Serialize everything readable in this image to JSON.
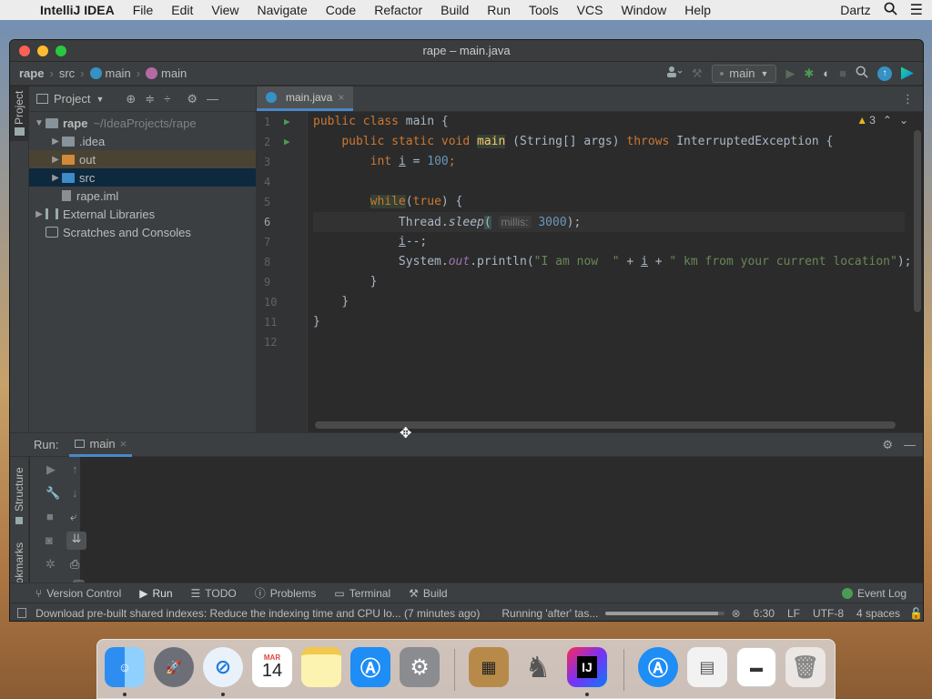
{
  "menubar": {
    "app": "IntelliJ IDEA",
    "items": [
      "File",
      "Edit",
      "View",
      "Navigate",
      "Code",
      "Refactor",
      "Build",
      "Run",
      "Tools",
      "VCS",
      "Window",
      "Help"
    ],
    "user": "Dartz"
  },
  "window": {
    "title": "rape – main.java"
  },
  "breadcrumb": {
    "project": "rape",
    "src": "src",
    "class": "main",
    "method": "main"
  },
  "toolbar": {
    "run_config": "main"
  },
  "project_panel": {
    "title": "Project",
    "tree": {
      "root_name": "rape",
      "root_path": "~/IdeaProjects/rape",
      "idea": ".idea",
      "out": "out",
      "src": "src",
      "iml": "rape.iml",
      "external": "External Libraries",
      "scratches": "Scratches and Consoles"
    }
  },
  "side_tabs": {
    "project": "Project",
    "structure": "Structure",
    "bookmarks": "Bookmarks"
  },
  "editor": {
    "tab": "main.java",
    "warning_count": "3",
    "line_numbers": [
      "1",
      "2",
      "3",
      "4",
      "5",
      "6",
      "7",
      "8",
      "9",
      "10",
      "11",
      "12"
    ],
    "code": {
      "l1_kw": "public class ",
      "l1_rest": "main {",
      "l2_kw": "public static void ",
      "l2_fn": "main",
      "l2_params": " (String[] args) ",
      "l2_throws": "throws",
      "l2_exc": " InterruptedException {",
      "l3_kw": "int ",
      "l3_var": "i",
      "l3_eq": " = ",
      "l3_num": "100",
      "l3_end": ";",
      "l5_while": "while",
      "l5_paren": "(",
      "l5_true": "true",
      "l5_end": ") {",
      "l6_obj": "Thread.",
      "l6_fn": "sleep",
      "l6_open": "(",
      "l6_hint": "millis:",
      "l6_num": "3000",
      "l6_end": ");",
      "l7_var": "i",
      "l7_end": "--;",
      "l8_obj": "System.",
      "l8_field": "out",
      "l8_call": ".println(",
      "l8_str1": "\"I am now  \"",
      "l8_plus1": " + ",
      "l8_var": "i",
      "l8_plus2": " + ",
      "l8_str2": "\" km from your current location\"",
      "l8_end": ");",
      "l9": "}",
      "l10": "}",
      "l11": "}"
    }
  },
  "run_panel": {
    "label": "Run:",
    "tab": "main"
  },
  "bottom_tools": [
    "Version Control",
    "Run",
    "TODO",
    "Problems",
    "Terminal",
    "Build"
  ],
  "event_log": "Event Log",
  "status": {
    "message": "Download pre-built shared indexes: Reduce the indexing time and CPU lo... (7 minutes ago)",
    "task": "Running 'after' tas...",
    "progress": 0.95,
    "position": "6:30",
    "line_sep": "LF",
    "encoding": "UTF-8",
    "indent": "4 spaces"
  },
  "dock": {
    "calendar_month": "MAR",
    "calendar_day": "14",
    "ij_label": "IJ"
  },
  "colors": {
    "accent": "#4a88c7",
    "keyword": "#cc7832",
    "function": "#ffc66d",
    "number": "#6897bb",
    "string": "#6a8759"
  }
}
